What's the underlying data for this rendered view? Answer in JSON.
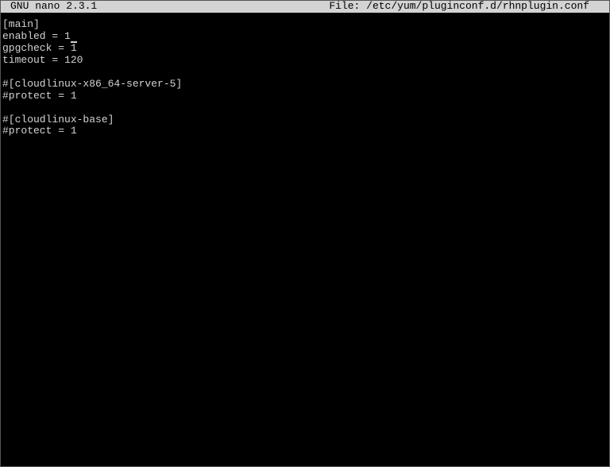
{
  "titlebar": {
    "app": "GNU nano 2.3.1",
    "file_label": "File: ",
    "file_path": "/etc/yum/pluginconf.d/rhnplugin.conf"
  },
  "editor": {
    "lines": [
      "[main]",
      "enabled = 1",
      "gpgcheck = 1",
      "timeout = 120",
      "",
      "#[cloudlinux-x86_64-server-5]",
      "#protect = 1",
      "",
      "#[cloudlinux-base]",
      "#protect = 1"
    ],
    "cursor_line": 1,
    "cursor_col": 11
  }
}
